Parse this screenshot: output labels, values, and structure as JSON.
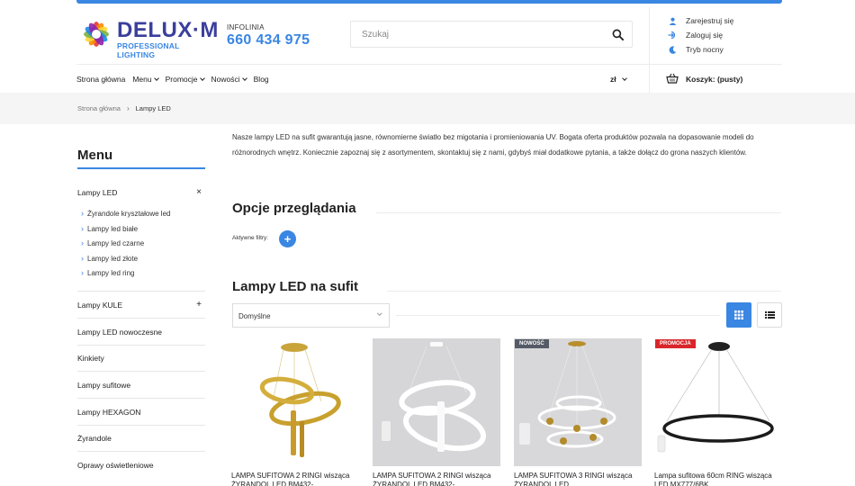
{
  "header": {
    "logo": {
      "title": "DELUX·M",
      "subtitle": "PROFESSIONAL LIGHTING"
    },
    "hotline": {
      "label": "INFOLINIA",
      "number": "660 434 975"
    },
    "search": {
      "placeholder": "Szukaj"
    },
    "account": [
      {
        "label": "Zarejestruj się",
        "icon": "user-icon"
      },
      {
        "label": "Zaloguj się",
        "icon": "login-icon"
      },
      {
        "label": "Tryb nocny",
        "icon": "moon-icon"
      }
    ],
    "nav": [
      {
        "label": "Strona główna",
        "dropdown": false
      },
      {
        "label": "Menu",
        "dropdown": true
      },
      {
        "label": "Promocje",
        "dropdown": true
      },
      {
        "label": "Nowości",
        "dropdown": true
      },
      {
        "label": "Blog",
        "dropdown": false
      }
    ],
    "currency": "zł",
    "cart": "Koszyk: (pusty)"
  },
  "breadcrumb": {
    "home": "Strona główna",
    "separator": "›",
    "current": "Lampy LED"
  },
  "sidebar": {
    "title": "Menu",
    "active": {
      "label": "Lampy LED",
      "sign": "×"
    },
    "subitems": [
      "Żyrandole kryształowe led",
      "Lampy led białe",
      "Lampy led czarne",
      "Lampy led złote",
      "Lampy led ring"
    ],
    "categories": [
      {
        "label": "Lampy KULE",
        "sign": "+"
      },
      {
        "label": "Lampy LED nowoczesne",
        "sign": ""
      },
      {
        "label": "Kinkiety",
        "sign": ""
      },
      {
        "label": "Lampy sufitowe",
        "sign": ""
      },
      {
        "label": "Lampy HEXAGON",
        "sign": ""
      },
      {
        "label": "Żyrandole",
        "sign": ""
      },
      {
        "label": "Oprawy oświetleniowe",
        "sign": ""
      }
    ]
  },
  "main": {
    "description": "Nasze lampy LED na sufit gwarantują jasne, równomierne światło bez migotania i promieniowania UV. Bogata oferta produktów pozwala na dopasowanie modeli do różnorodnych wnętrz. Koniecznie zapoznaj się z asortymentem, skontaktuj się z nami, gdybyś miał dodatkowe pytania, a także dołącz do grona naszych klientów.",
    "browse_title": "Opcje przeglądania",
    "active_filters": "Aktywne filtry:",
    "add_filter": "+",
    "listing_title": "Lampy LED na sufit",
    "sort_value": "Domyślne",
    "products": [
      {
        "name": "LAMPA SUFITOWA 2 RINGI wisząca ŻYRANDOL LED BM432-",
        "badge": ""
      },
      {
        "name": "LAMPA SUFITOWA 2 RINGI wisząca ŻYRANDOL LED BM432-",
        "badge": ""
      },
      {
        "name": "LAMPA SUFITOWA 3 RINGI wisząca ŻYRANDOL LED",
        "badge": "NOWOŚĆ"
      },
      {
        "name": "Lampa sufitowa 60cm RING wisząca LED MX777/6BK",
        "badge": "PROMOCJA"
      }
    ]
  },
  "colors": {
    "accent": "#3a86e3",
    "promo": "#d9262b",
    "new": "#555b66"
  }
}
